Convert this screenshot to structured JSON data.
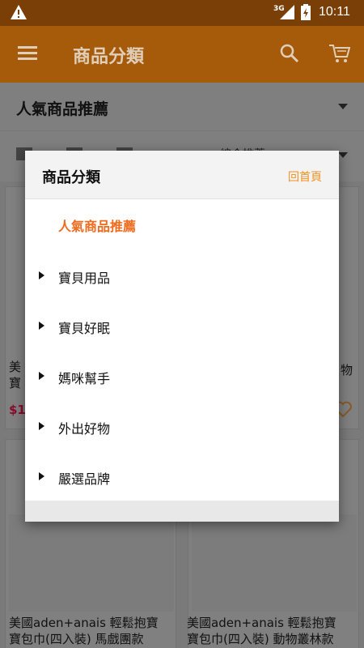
{
  "status_bar": {
    "network": "3G",
    "time": "10:11"
  },
  "app_bar": {
    "title": "商品分類"
  },
  "category_bar": {
    "selected": "人氣商品推薦"
  },
  "view_bar": {
    "sort_label": "綜合推薦"
  },
  "products": [
    {
      "name_line1": "美",
      "name_line2": "寶",
      "price": "$1"
    },
    {
      "name_line1": "物"
    },
    {
      "name_line1": "美國aden+anais 輕鬆抱寶",
      "name_line2": "寶包巾(四入裝) 馬戲團款"
    },
    {
      "name_line1": "美國aden+anais 輕鬆抱寶",
      "name_line2": "寶包巾(四入裝) 動物叢林款"
    }
  ],
  "dialog": {
    "title": "商品分類",
    "home_link": "回首頁",
    "items": [
      {
        "label": "人氣商品推薦",
        "active": true
      },
      {
        "label": "寶貝用品"
      },
      {
        "label": "寶貝好眠"
      },
      {
        "label": "媽咪幫手"
      },
      {
        "label": "外出好物"
      },
      {
        "label": "嚴選品牌"
      }
    ]
  },
  "colors": {
    "app_bar": "#a65b0a",
    "status_bar": "#7a3f06",
    "accent": "#f26a1b",
    "home_link": "#f0921f",
    "price": "#8a0a2a"
  }
}
